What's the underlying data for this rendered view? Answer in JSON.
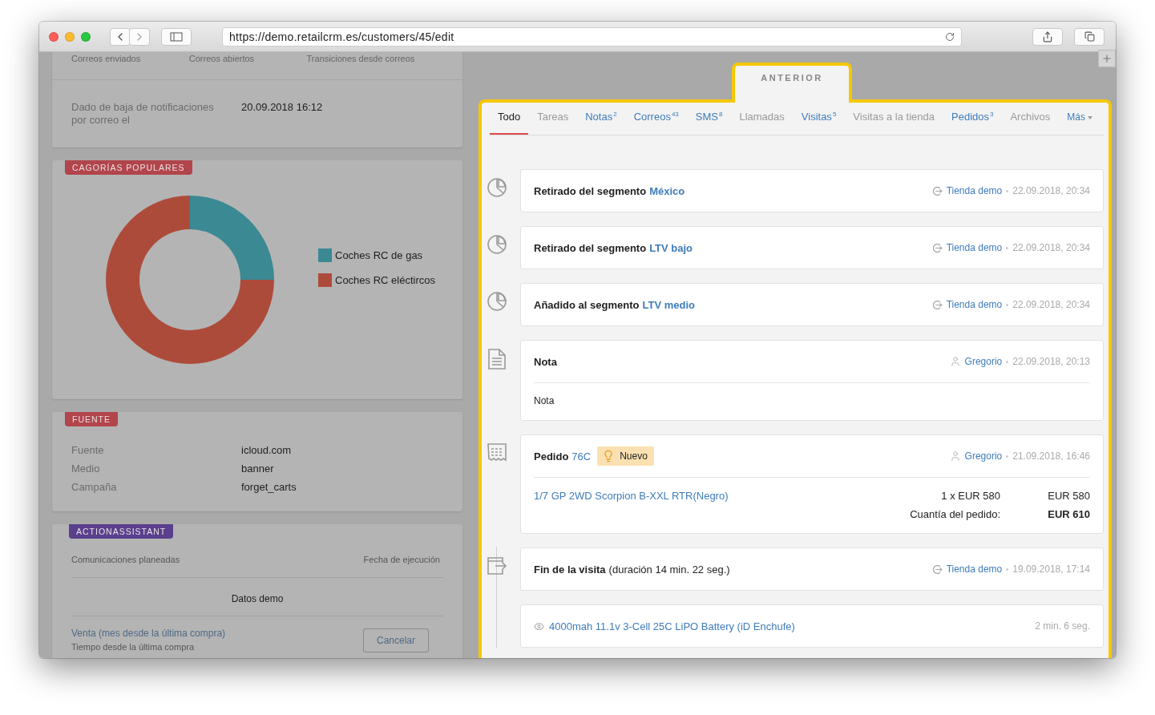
{
  "browser": {
    "url": "https://demo.retailcrm.es/customers/45/edit"
  },
  "left": {
    "email_stats": {
      "labels": [
        "Correos enviados",
        "Correos abiertos",
        "Transiciones desde correos"
      ]
    },
    "unsubscribe": {
      "label": "Dado de baja de notificaciones por correo el",
      "value": "20.09.2018 16:12"
    },
    "categories": {
      "badge": "CAGORÍAS POPULARES",
      "legend": [
        {
          "label": "Coches RC de gas",
          "color": "#3b8993"
        },
        {
          "label": "Coches RC eléctircos",
          "color": "#ad4b3b"
        }
      ]
    },
    "source": {
      "badge": "FUENTE",
      "rows": [
        {
          "label": "Fuente",
          "value": "icloud.com"
        },
        {
          "label": "Medio",
          "value": "banner"
        },
        {
          "label": "Campaña",
          "value": "forget_carts"
        }
      ]
    },
    "action_assistant": {
      "badge": "ACTIONASSISTANT",
      "columns": [
        "Comunicaciones planeadas",
        "Fecha de ejecución"
      ],
      "empty_text": "Datos demo",
      "trigger": {
        "title": "Venta (mes desde la última compra)",
        "subtitle": "Tiempo desde la última compra"
      },
      "button": "Cancelar"
    }
  },
  "right": {
    "panel_tab": "ANTERIOR",
    "tabs": [
      {
        "label": "Todo",
        "selected": true,
        "disabled": false
      },
      {
        "label": "Tareas",
        "selected": false,
        "disabled": true
      },
      {
        "label": "Notas",
        "count": "2",
        "selected": false,
        "disabled": false
      },
      {
        "label": "Correos",
        "count": "43",
        "selected": false,
        "disabled": false
      },
      {
        "label": "SMS",
        "count": "8",
        "selected": false,
        "disabled": false
      },
      {
        "label": "Llamadas",
        "selected": false,
        "disabled": true
      },
      {
        "label": "Visitas",
        "count": "5",
        "selected": false,
        "disabled": false
      },
      {
        "label": "Visitas a la tienda",
        "selected": false,
        "disabled": true
      },
      {
        "label": "Pedidos",
        "count": "3",
        "selected": false,
        "disabled": false
      },
      {
        "label": "Archivos",
        "selected": false,
        "disabled": true
      },
      {
        "label": "Más",
        "kind": "dropdown",
        "selected": false,
        "disabled": false
      }
    ],
    "events": [
      {
        "kind": "segment",
        "title": "Retirado del segmento",
        "link": "México",
        "author": {
          "kind": "shop",
          "name": "Tienda demo"
        },
        "date": "22.09.2018, 20:34"
      },
      {
        "kind": "segment",
        "title": "Retirado del segmento",
        "link": "LTV bajo",
        "author": {
          "kind": "shop",
          "name": "Tienda demo"
        },
        "date": "22.09.2018, 20:34"
      },
      {
        "kind": "segment",
        "title": "Añadido al segmento",
        "link": "LTV medio",
        "author": {
          "kind": "shop",
          "name": "Tienda demo"
        },
        "date": "22.09.2018, 20:34"
      },
      {
        "kind": "note",
        "title": "Nota",
        "author": {
          "kind": "user",
          "name": "Gregorio"
        },
        "date": "22.09.2018, 20:13",
        "body": "Nota"
      },
      {
        "kind": "order",
        "title": "Pedido",
        "link": "76C",
        "status": "Nuevo",
        "author": {
          "kind": "user",
          "name": "Gregorio"
        },
        "date": "21.09.2018, 16:46",
        "items": [
          {
            "name": "1/7 GP 2WD Scorpion B-XXL RTR(Negro)",
            "quantity": "1 x EUR 580",
            "total": "EUR 580"
          }
        ],
        "summary": {
          "label": "Cuantía del pedido:",
          "value": "EUR 610"
        }
      },
      {
        "kind": "visit",
        "title": "Fin de la visita",
        "detail": "(duración 14 min. 22 seg.)",
        "author": {
          "kind": "shop",
          "name": "Tienda demo"
        },
        "date": "19.09.2018, 17:14"
      },
      {
        "kind": "page_view",
        "link": "4000mah 11.1v 3-Cell 25C LiPO Battery (iD Enchufe)",
        "duration": "2 min. 6 seg."
      }
    ]
  }
}
